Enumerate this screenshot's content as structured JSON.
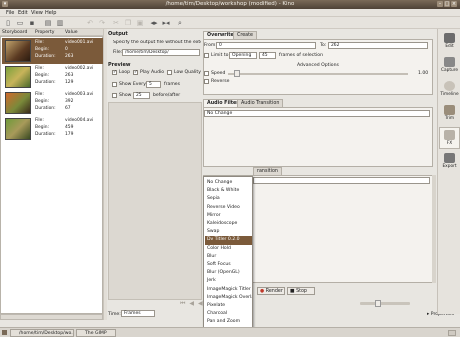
{
  "window": {
    "title": "/home/tim/Desktop/workshop (modified) - Kino"
  },
  "menu": [
    "File",
    "Edit",
    "View",
    "Help"
  ],
  "storyboard": {
    "columns": [
      "Storyboard",
      "Property",
      "Value"
    ],
    "rows": [
      {
        "file": "video001.avi",
        "begin": "0",
        "duration": "263",
        "selected": true
      },
      {
        "file": "video002.avi",
        "begin": "263",
        "duration": "129",
        "selected": false
      },
      {
        "file": "video003.avi",
        "begin": "392",
        "duration": "67",
        "selected": false
      },
      {
        "file": "video004.avi",
        "begin": "459",
        "duration": "179",
        "selected": false
      }
    ],
    "prop_labels": {
      "file": "File:",
      "begin": "Begin:",
      "duration": "Duration:"
    }
  },
  "output": {
    "header": "Output",
    "description": "Specify the output file without the extensi",
    "file_label": "File:",
    "file_value": "/home/tim/Desktop/"
  },
  "preview": {
    "header": "Preview",
    "loop": "Loop",
    "play_audio": "Play Audio",
    "low_quality": "Low Quality",
    "show_every": "Show Every",
    "show_every_value": "5",
    "frames": "frames",
    "show": "Show",
    "show_value": "25",
    "before_after": "before/after"
  },
  "tabs_top": [
    "Overwrite",
    "Create"
  ],
  "range": {
    "from_label": "From:",
    "from_value": "0",
    "to_label": "To:",
    "to_value": "262",
    "limit_label": "Limit to:",
    "limit_mode": "Opening",
    "limit_value": "45",
    "limit_suffix": "frames of selection",
    "advanced": "Advanced Options",
    "speed": "Speed",
    "speed_value": "1.00",
    "reverse": "Reverse"
  },
  "audio_tabs": [
    "Audio Filter",
    "Audio Transition"
  ],
  "audio_filter_value": "No Change",
  "video_transition_tab": "ransition",
  "dropdown_items": [
    "No Change",
    "Black & White",
    "Sepia",
    "Reverse Video",
    "Mirror",
    "Kaleidoscope",
    "Swap",
    "Dv Titler 0.2.0",
    "Color Hold",
    "Blur",
    "Soft Focus",
    "Blur (OpenGL)",
    "Jerk",
    "ImageMagick Titler",
    "ImageMagick Overlay",
    "Pixelate",
    "Charcoal",
    "Pan and Zoom",
    "Colour Average"
  ],
  "dropdown_selected_index": 7,
  "render_buttons": {
    "render": "Render",
    "stop": "Stop"
  },
  "time": {
    "label": "Time:",
    "value": "Frames"
  },
  "properties": "Properties",
  "right_sidebar": [
    "Edit",
    "Capture",
    "Timeline",
    "Trim",
    "FX",
    "Export"
  ],
  "right_sidebar_active": "FX",
  "taskbar": [
    "/home/tim/Desktop/wo...",
    "The GIMP"
  ],
  "colors": {
    "selection": "#7b5a3a",
    "titlebar": "#5a4c3e"
  }
}
